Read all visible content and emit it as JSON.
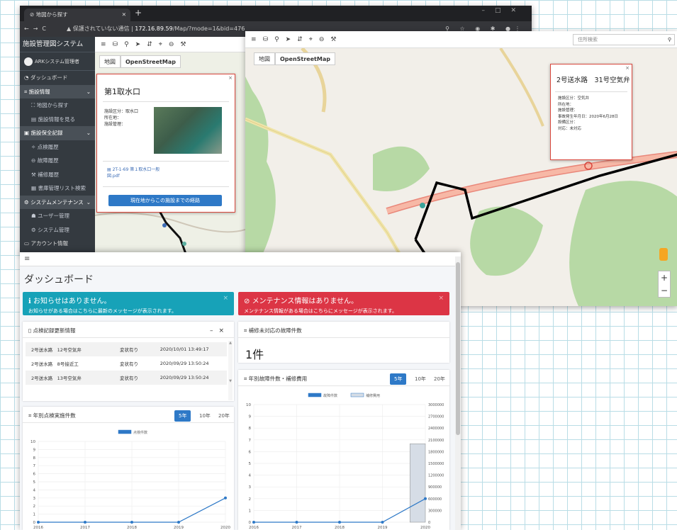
{
  "browser": {
    "tab_title": "地図から探す",
    "url_warn": "保護されていない通信",
    "url_host": "172.16.89.59",
    "url_path": "/Map/?mode=1&bid=476"
  },
  "sidebar": {
    "brand": "施設管理図システム",
    "user": "ARKシステム管理者",
    "items": [
      {
        "label": "ダッシュボード",
        "icon": "tachometer-icon",
        "type": "top"
      },
      {
        "label": "施設情報",
        "icon": "chart-icon",
        "type": "header",
        "caret": "⌄"
      },
      {
        "label": "地図から探す",
        "icon": "map-icon",
        "type": "sub"
      },
      {
        "label": "施設情報を見る",
        "icon": "list-icon",
        "type": "sub"
      },
      {
        "label": "施設保全記録",
        "icon": "book-icon",
        "type": "header",
        "caret": "⌄"
      },
      {
        "label": "点検履歴",
        "icon": "wrench-icon",
        "type": "sub"
      },
      {
        "label": "故障履歴",
        "icon": "minus-circle-icon",
        "type": "sub"
      },
      {
        "label": "補修履歴",
        "icon": "hammer-icon",
        "type": "sub"
      },
      {
        "label": "書庫管理リスト検索",
        "icon": "archive-icon",
        "type": "sub"
      },
      {
        "label": "システムメンテナンス",
        "icon": "gear-icon",
        "type": "header",
        "caret": "⌄"
      },
      {
        "label": "ユーザー管理",
        "icon": "user-icon",
        "type": "sub"
      },
      {
        "label": "システム管理",
        "icon": "cogs-icon",
        "type": "sub"
      },
      {
        "label": "アカウント情報",
        "icon": "id-card-icon",
        "type": "top"
      }
    ]
  },
  "map_tabs": {
    "map": "地図",
    "osm": "OpenStreetMap"
  },
  "popup1": {
    "title": "第1取水口",
    "info": [
      "施設区分：取水口",
      "所在地：",
      "施設管理："
    ],
    "file": [
      "2T-1-69 第１取水口一般",
      "図.pdf"
    ],
    "route_btn": "現在地からこの施設までの経路"
  },
  "search": {
    "placeholder": "住所検索"
  },
  "popup2": {
    "title": "2号送水路　31号空気弁",
    "info": [
      "施設区分：空気弁",
      "所在地：",
      "施設管理：",
      "事故発生年月日：2020年6月28日",
      "設備区分：",
      "対応：未対応"
    ]
  },
  "dashboard": {
    "title": "ダッシュボード",
    "alert_info": {
      "title": "お知らせはありません。",
      "text": "お知らせがある場合はこちらに最新のメッセージが表示されます。"
    },
    "alert_maint": {
      "title": "メンテナンス情報はありません。",
      "text": "メンテナンス情報がある場合はこちらにメッセージが表示されます。"
    },
    "inspect": {
      "title": "点検記録更新情報",
      "rows": [
        {
          "name": "2号送水路　12号空気弁",
          "status": "変状有り",
          "date": "2020/10/01 13:49:17"
        },
        {
          "name": "2号送水路　8号接近工",
          "status": "変状有り",
          "date": "2020/09/29 13:50:24"
        },
        {
          "name": "2号送水路　13号空気弁",
          "status": "変状有り",
          "date": "2020/09/29 13:50:24"
        }
      ]
    },
    "unrepaired": {
      "title": "補修未対応の故障件数",
      "count": "1件"
    },
    "periods": [
      "5年",
      "10年",
      "20年"
    ]
  },
  "chart_data": [
    {
      "type": "line",
      "title": "年別点検実施件数",
      "legend": [
        "点検件数"
      ],
      "x": [
        "2016",
        "2017",
        "2018",
        "2019",
        "2020"
      ],
      "series": [
        {
          "name": "点検件数",
          "values": [
            0,
            0,
            0,
            0,
            3
          ]
        }
      ],
      "ylim": [
        0,
        10
      ],
      "yticks": [
        0,
        1,
        2,
        3,
        4,
        5,
        6,
        7,
        8,
        9,
        10
      ],
      "color": "#2e79c7"
    },
    {
      "type": "bar+line",
      "title": "年別故障件数・補修費用",
      "legend": [
        "故障件数",
        "補修費用"
      ],
      "x": [
        "2016",
        "2017",
        "2018",
        "2019",
        "2020"
      ],
      "series": [
        {
          "name": "故障件数",
          "type": "line",
          "axis": "left",
          "values": [
            0,
            0,
            0,
            0,
            2
          ]
        },
        {
          "name": "補修費用",
          "type": "bar",
          "axis": "right",
          "values": [
            0,
            0,
            0,
            0,
            2000000
          ]
        }
      ],
      "ylim": [
        0,
        10
      ],
      "y2lim": [
        0,
        3000000
      ],
      "yticks": [
        0,
        1,
        2,
        3,
        4,
        5,
        6,
        7,
        8,
        9,
        10
      ],
      "y2ticks": [
        0,
        300000,
        600000,
        900000,
        1200000,
        1500000,
        1800000,
        2100000,
        2400000,
        2700000,
        3000000
      ],
      "color": "#2e79c7",
      "bar_color": "#d6dde6"
    }
  ]
}
